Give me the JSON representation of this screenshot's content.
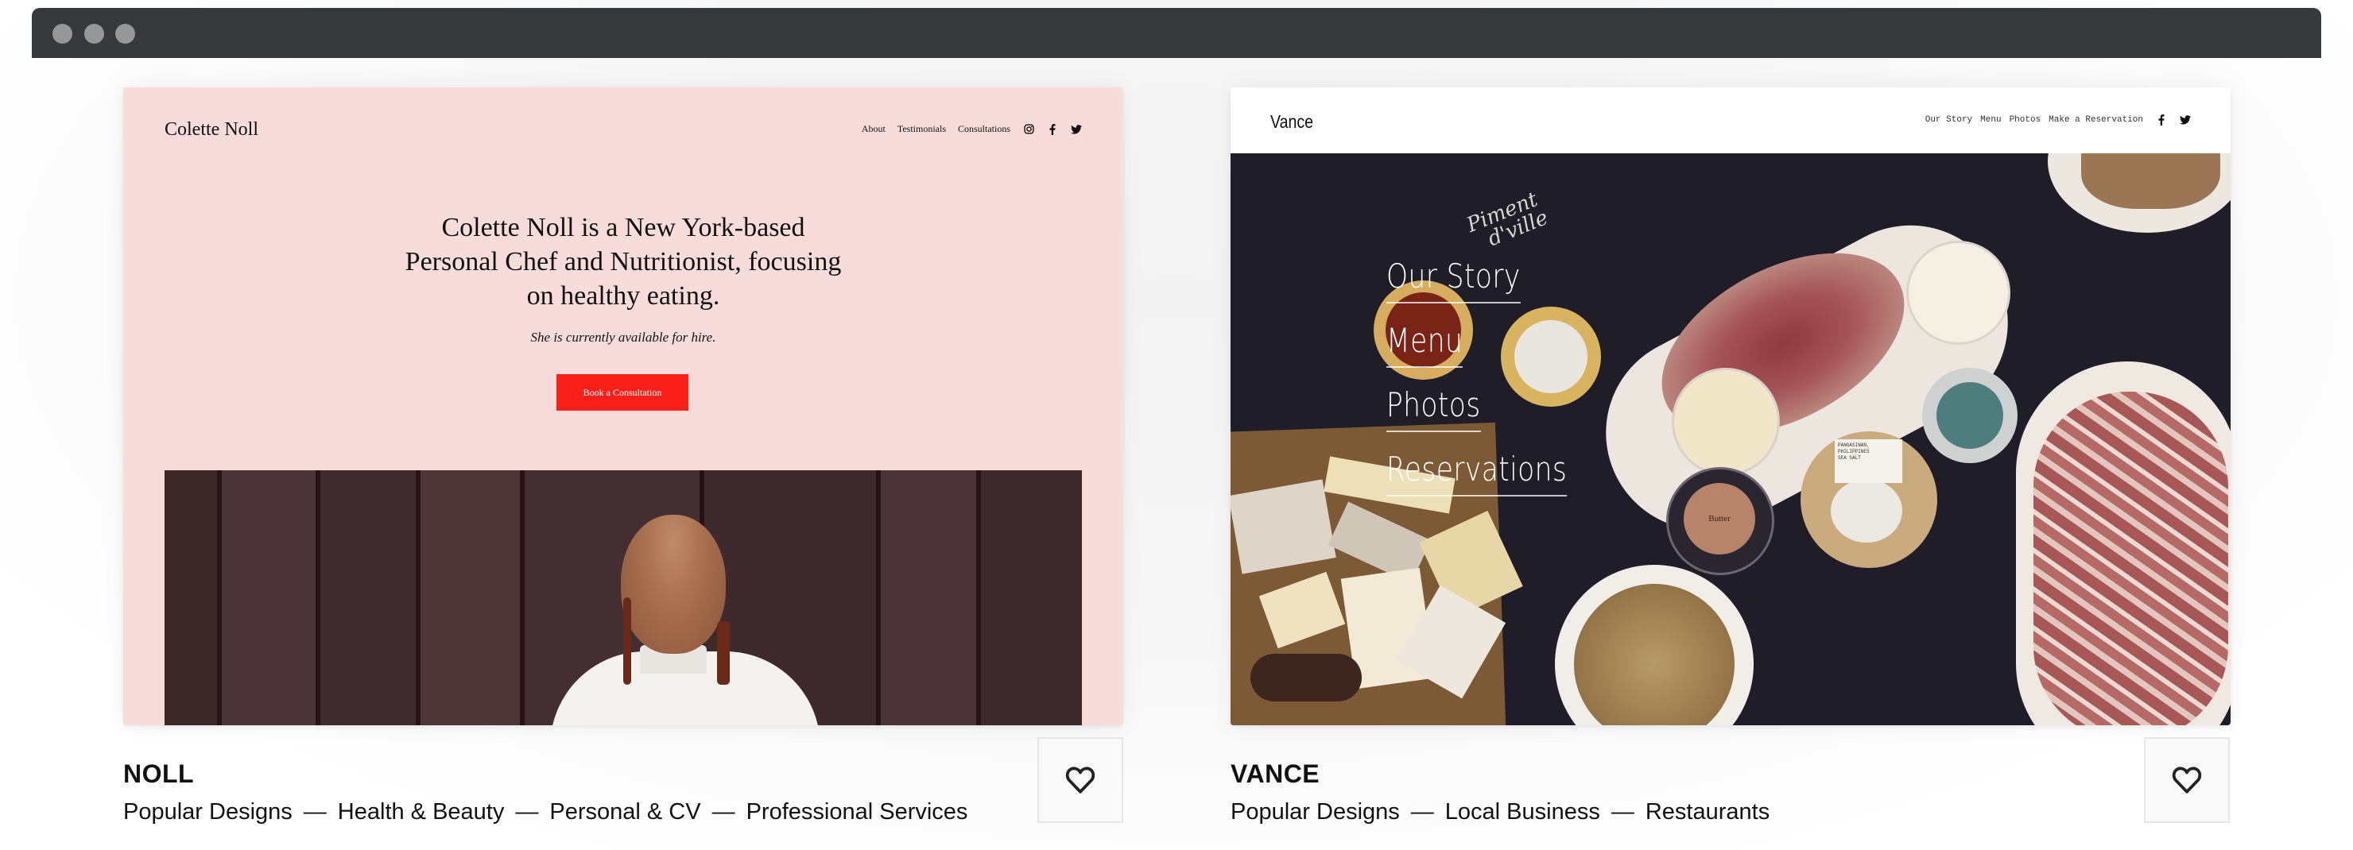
{
  "window": {
    "controls": [
      "close-dot",
      "minimize-dot",
      "maximize-dot"
    ]
  },
  "templates": [
    {
      "id": "noll",
      "name": "NOLL",
      "categories": [
        "Popular Designs",
        "Health & Beauty",
        "Personal & CV",
        "Professional Services"
      ],
      "separator": "—",
      "favorite_icon": "heart-outline-icon",
      "preview": {
        "background_color": "#f8dcd9",
        "logo": "Colette Noll",
        "nav": [
          "About",
          "Testimonials",
          "Consultations"
        ],
        "social_icons": [
          "instagram-icon",
          "facebook-icon",
          "twitter-icon"
        ],
        "headline_lines": [
          "Colette Noll is a New York-based",
          "Personal Chef and Nutritionist, focusing",
          "on healthy eating."
        ],
        "subtext": "She is currently available for hire.",
        "cta_label": "Book a Consultation",
        "cta_color": "#fb2019"
      }
    },
    {
      "id": "vance",
      "name": "VANCE",
      "categories": [
        "Popular Designs",
        "Local Business",
        "Restaurants"
      ],
      "separator": "—",
      "favorite_icon": "heart-outline-icon",
      "preview": {
        "logo": "Vance",
        "nav": [
          "Our Story",
          "Menu",
          "Photos",
          "Make a Reservation"
        ],
        "social_icons": [
          "facebook-icon",
          "twitter-icon"
        ],
        "hero_links": [
          "Our Story",
          "Menu",
          "Photos",
          "Reservations"
        ],
        "chalk_text": [
          "Piment",
          "d'ville"
        ],
        "salt_label": [
          "PANGASINAN, PHILIPPINES",
          "SEA SALT"
        ],
        "butter_label": "Butter"
      }
    }
  ]
}
